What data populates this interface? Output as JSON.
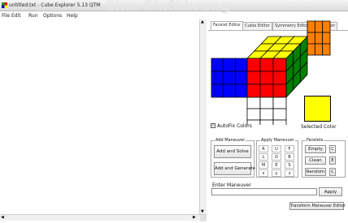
{
  "window": {
    "title": "untitled.txt - Cube Explorer 5.13 QTM",
    "background_text": "Eine Einführung"
  },
  "menu": [
    "File",
    "Edit",
    "Run",
    "Options",
    "Help"
  ],
  "tabs": [
    {
      "label": "Facelet Editor",
      "active": true
    },
    {
      "label": "Cubie Editor",
      "active": false
    },
    {
      "label": "Symmetry Editor",
      "active": false
    },
    {
      "label": "Web Editor",
      "active": false
    }
  ],
  "cube": {
    "colors": {
      "yellow": "#ffff00",
      "orange": "#ff8000",
      "green": "#008000",
      "blue": "#0000ff",
      "red": "#ff0000",
      "white": "#ffffff",
      "grid": "#000000"
    },
    "autofix_label": "AutoFix Colors",
    "autofix_checked": true,
    "selected_color_label": "Selected Color",
    "selected_color": "#ffff00"
  },
  "add_maneuver": {
    "label": "Add Maneuver",
    "solve_button": "Add and Solve",
    "generate_button": "Add and Generate"
  },
  "apply_maneuver": {
    "label": "Apply Maneuver",
    "cells": [
      "R",
      "U",
      "F",
      "L",
      "D",
      "B",
      "M",
      "E",
      "S",
      "x",
      "y",
      "z"
    ]
  },
  "facelets": {
    "label": "Facelets",
    "empty_button": "Empty",
    "clean_button": "Clean",
    "random_button": "Random",
    "side_letters": [
      "C",
      "E",
      "C"
    ]
  },
  "enter_maneuver": {
    "label": "Enter Maneuver",
    "value": "",
    "apply_button": "Apply"
  },
  "footer_button": "Transform Maneuver Editor"
}
